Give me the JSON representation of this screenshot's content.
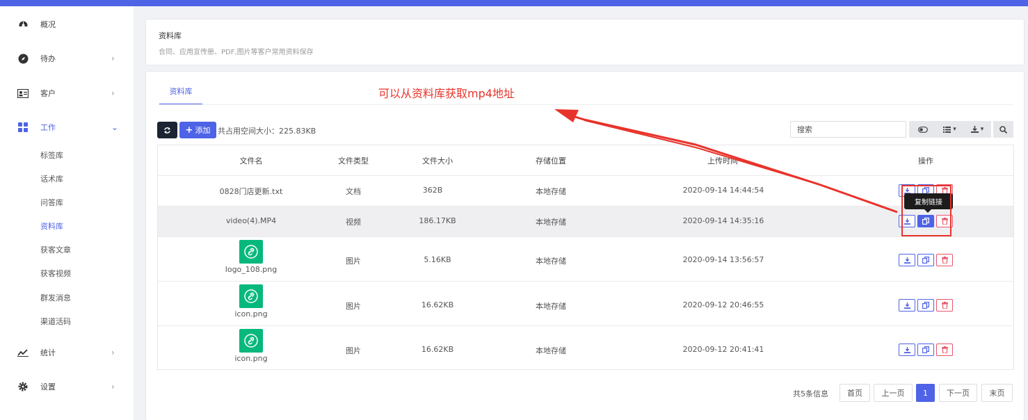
{
  "sidebar": {
    "items": [
      {
        "label": "概况",
        "icon": "dashboard-icon"
      },
      {
        "label": "待办",
        "icon": "compass-icon"
      },
      {
        "label": "客户",
        "icon": "contact-card-icon"
      },
      {
        "label": "工作",
        "icon": "grid-icon"
      },
      {
        "label": "统计",
        "icon": "trend-icon"
      },
      {
        "label": "设置",
        "icon": "gear-icon"
      }
    ],
    "work_sub": [
      "标签库",
      "话术库",
      "问答库",
      "资料库",
      "获客文章",
      "获客视频",
      "群发消息",
      "渠道活码"
    ],
    "active_sub": "资料库"
  },
  "header": {
    "title": "资料库",
    "subtitle": "合同、应用宣传册、PDF,图片等客户常用资料保存"
  },
  "tab_label": "资料库",
  "annotation": "可以从资料库获取mp4地址",
  "toolbar": {
    "add_label": "添加",
    "space_info": "共占用空间大小：225.83KB",
    "search_placeholder": "搜索"
  },
  "table": {
    "headers": [
      "文件名",
      "文件类型",
      "文件大小",
      "存储位置",
      "上传时间",
      "操作"
    ],
    "rows": [
      {
        "name": "0828门店更新.txt",
        "type": "文档",
        "size": "362B",
        "storage": "本地存储",
        "time": "2020-09-14 14:44:54",
        "thumb": false
      },
      {
        "name": "video(4).MP4",
        "type": "视频",
        "size": "186.17KB",
        "storage": "本地存储",
        "time": "2020-09-14 14:35:16",
        "thumb": false
      },
      {
        "name": "logo_108.png",
        "type": "图片",
        "size": "5.16KB",
        "storage": "本地存储",
        "time": "2020-09-14 13:56:57",
        "thumb": true
      },
      {
        "name": "icon.png",
        "type": "图片",
        "size": "16.62KB",
        "storage": "本地存储",
        "time": "2020-09-12 20:46:55",
        "thumb": true
      },
      {
        "name": "icon.png",
        "type": "图片",
        "size": "16.62KB",
        "storage": "本地存储",
        "time": "2020-09-12 20:41:41",
        "thumb": true
      }
    ]
  },
  "tooltip": "复制链接",
  "pager": {
    "info": "共5条信息",
    "first": "首页",
    "prev": "上一页",
    "current": "1",
    "next": "下一页",
    "last": "末页"
  }
}
